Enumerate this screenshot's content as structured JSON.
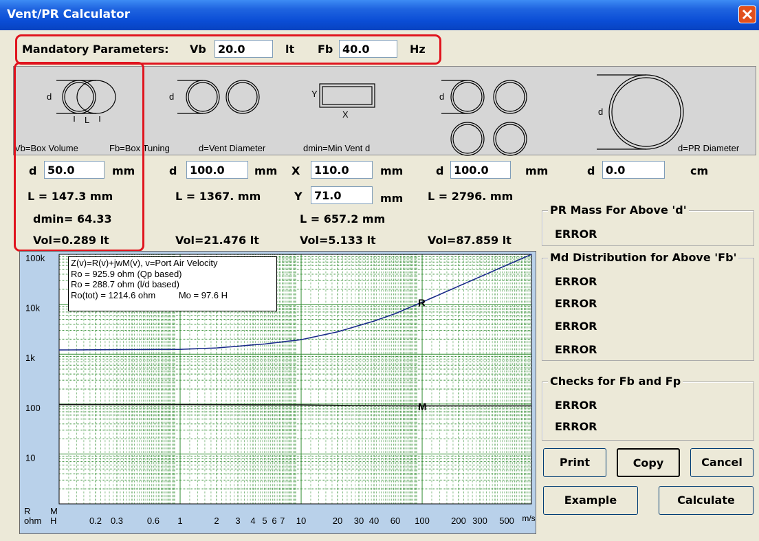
{
  "window": {
    "title": "Vent/PR Calculator"
  },
  "mandatory": {
    "label": "Mandatory Parameters:",
    "vb_label": "Vb",
    "vb_value": "20.0",
    "vb_unit": "lt",
    "fb_label": "Fb",
    "fb_value": "40.0",
    "fb_unit": "Hz"
  },
  "diagram_labels": {
    "vb": "Vb=Box Volume",
    "fb": "Fb=Box Tuning",
    "d": "d=Vent Diameter",
    "dmin": "dmin=Min Vent d",
    "pr": "d=PR Diameter",
    "d_letter": "d",
    "l_letter": "L",
    "x_letter": "X",
    "y_letter": "Y"
  },
  "col1": {
    "d_label": "d",
    "d_value": "50.0",
    "d_unit": "mm",
    "L": "L = 147.3 mm",
    "dmin": "dmin= 64.33",
    "vol": "Vol=0.289 lt"
  },
  "col2": {
    "d_label": "d",
    "d_value": "100.0",
    "d_unit": "mm",
    "L": "L = 1367. mm",
    "vol": "Vol=21.476 lt"
  },
  "col3": {
    "x_label": "X",
    "x_value": "110.0",
    "x_unit": "mm",
    "y_label": "Y",
    "y_value": "71.0",
    "y_unit": "mm",
    "L": "L = 657.2 mm",
    "vol": "Vol=5.133 lt"
  },
  "col4": {
    "d_label": "d",
    "d_value": "100.0",
    "d_unit": "mm",
    "L": "L = 2796. mm",
    "vol": "Vol=87.859 lt"
  },
  "col5": {
    "d_label": "d",
    "d_value": "0.0",
    "d_unit": "cm"
  },
  "pr_mass": {
    "title": "PR Mass For Above 'd'",
    "result": "ERROR"
  },
  "md_dist": {
    "title": "Md Distribution for Above 'Fb'",
    "results": [
      "ERROR",
      "ERROR",
      "ERROR",
      "ERROR"
    ]
  },
  "checks": {
    "title": "Checks for Fb and Fp",
    "results": [
      "ERROR",
      "ERROR"
    ]
  },
  "buttons": {
    "print": "Print",
    "copy": "Copy",
    "cancel": "Cancel",
    "example": "Example",
    "calculate": "Calculate"
  },
  "chart_data": {
    "type": "line",
    "x_scale": "log",
    "y_scale": "log",
    "xlim": [
      0.1,
      800
    ],
    "ylim": [
      1,
      100000
    ],
    "x_ticks": [
      "0.2",
      "0.3",
      "0.6",
      "1",
      "2",
      "3",
      "4",
      "5",
      "6",
      "7",
      "10",
      "20",
      "30",
      "40",
      "60",
      "100",
      "200",
      "300",
      "500"
    ],
    "x_unit": "m/s",
    "y_ticks": [
      "100k",
      "10k",
      "1k",
      "100",
      "10"
    ],
    "y_axis_labels": [
      "R",
      "M",
      "ohm",
      "H"
    ],
    "legend_lines": [
      "Z(v)=R(v)+jwM(v), v=Port Air Velocity",
      "Ro = 925.9 ohm (Qp based)",
      "Ro = 288.7 ohm (l/d based)",
      "Ro(tot) = 1214.6 ohm",
      "Mo = 97.6 H"
    ],
    "series": [
      {
        "name": "R",
        "x": [
          0.1,
          1,
          2,
          5,
          10,
          20,
          40,
          60,
          100,
          200,
          400,
          800
        ],
        "y": [
          1214,
          1250,
          1330,
          1600,
          1950,
          2800,
          4600,
          6500,
          11000,
          23000,
          48000,
          100000
        ]
      },
      {
        "name": "M",
        "x": [
          0.1,
          1,
          10,
          30,
          100,
          800
        ],
        "y": [
          97.6,
          97.5,
          96,
          93,
          92,
          92
        ]
      }
    ],
    "grid": true,
    "colors": {
      "R": "#1a2a8a",
      "M": "#111111",
      "grid": "#2e8b2e",
      "bg": "#b9d1ea",
      "plot_bg": "#ffffff"
    }
  }
}
